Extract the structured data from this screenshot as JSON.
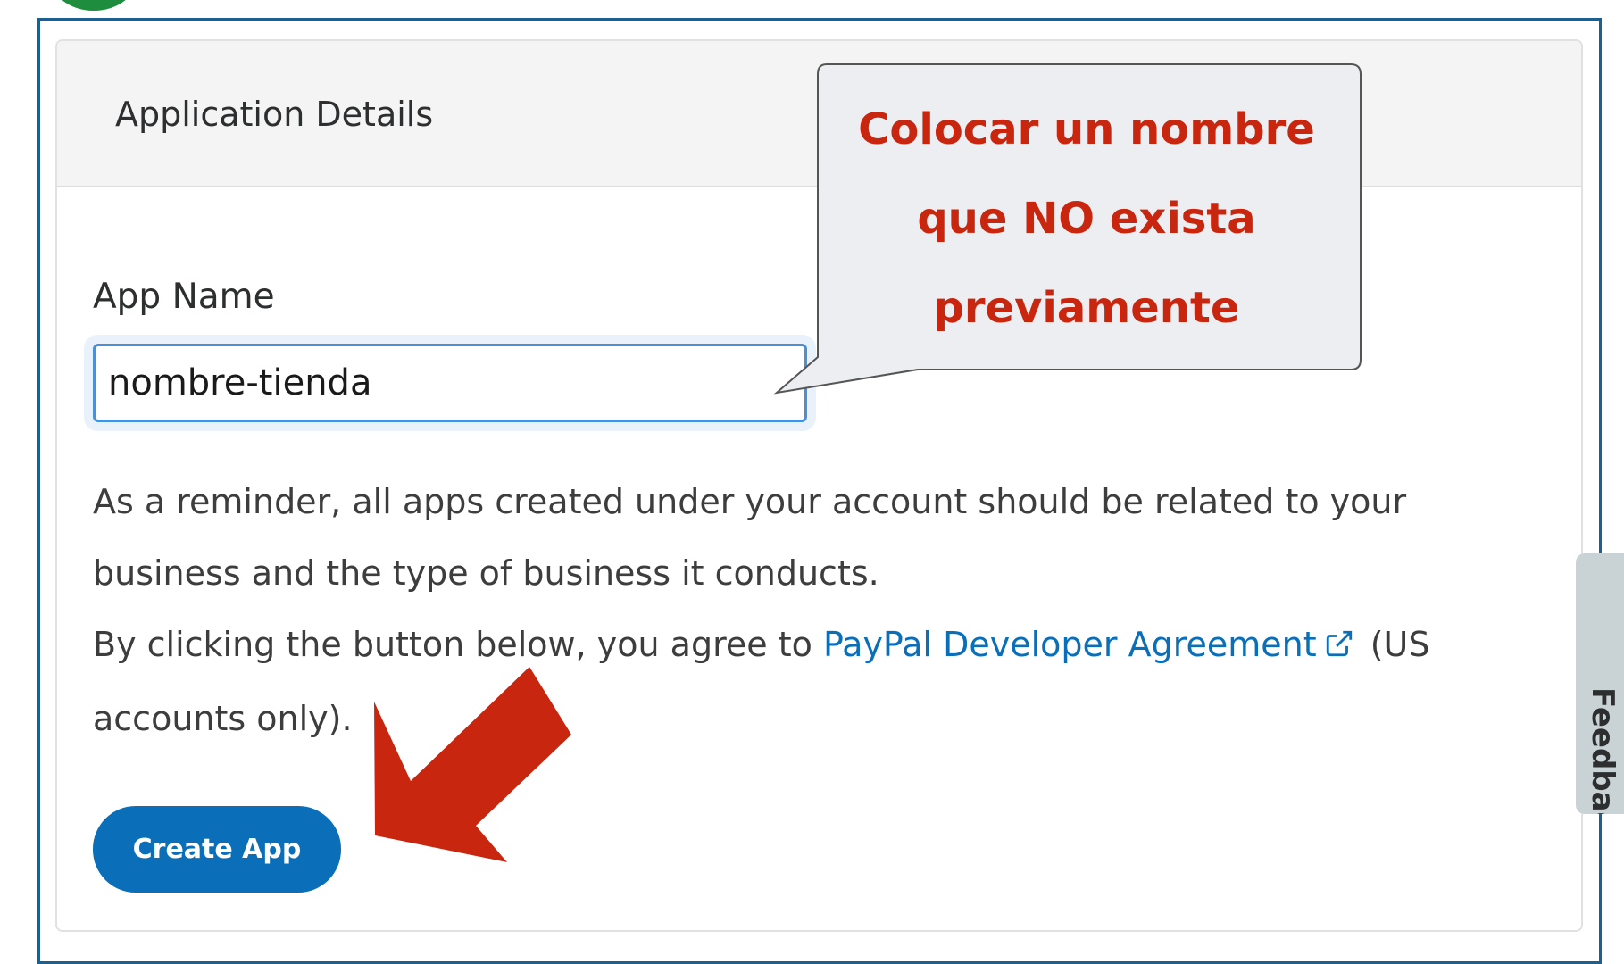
{
  "card": {
    "title": "Application Details"
  },
  "form": {
    "app_name_label": "App Name",
    "app_name_value": "nombre-tienda",
    "reminder_line": "As a reminder, all apps created under your account should be related to your business and the type of business it conducts.",
    "agree_prefix": "By clicking the button below, you agree to ",
    "agreement_link": "PayPal Developer Agreement",
    "agree_suffix": " (US accounts only).",
    "create_button": "Create App"
  },
  "feedback_tab": {
    "label": "Feedback"
  },
  "annotation": {
    "callout_line_1": "Colocar un nombre",
    "callout_line_2": "que NO exista",
    "callout_line_3": "previamente",
    "arrow_color": "#c8260e",
    "callout_bg": "#eceef1"
  },
  "colors": {
    "frame_border": "#1f5f8f",
    "button_bg": "#0a6fb8",
    "link": "#0a6fb8",
    "callout_text": "#c8260e"
  },
  "icons": {
    "external_link": "external-link-icon"
  }
}
